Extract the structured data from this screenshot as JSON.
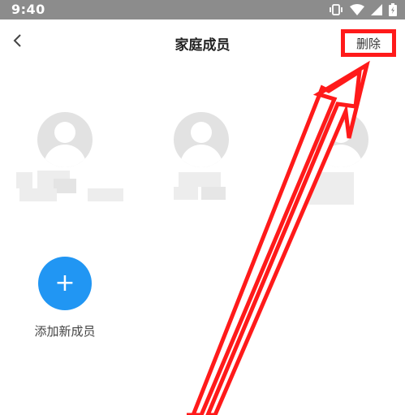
{
  "status_bar": {
    "time": "9:40"
  },
  "header": {
    "title": "家庭成员",
    "delete_label": "删除"
  },
  "add_member": {
    "icon": "+",
    "label": "添加新成员"
  },
  "colors": {
    "accent": "#2196f3",
    "annotation": "#ff1a1a",
    "status_bar": "#8c8c8c"
  }
}
